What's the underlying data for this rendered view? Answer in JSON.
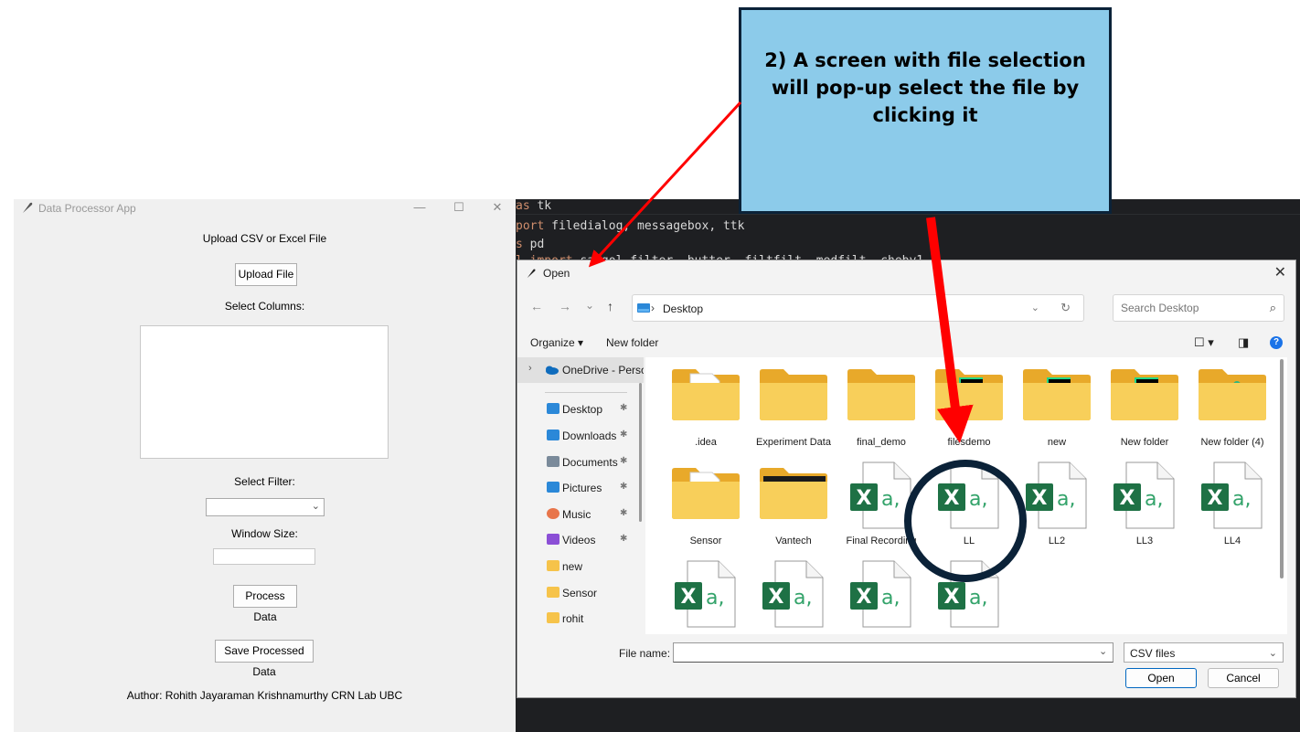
{
  "tk_app": {
    "title": "Data Processor App",
    "window_controls": {
      "minimize": "—",
      "maximize": "☐",
      "close": "✕"
    },
    "upload_label": "Upload CSV or Excel File",
    "upload_button": "Upload File",
    "select_columns_label": "Select Columns:",
    "select_filter_label": "Select Filter:",
    "filter_value": "",
    "window_size_label": "Window Size:",
    "window_size_value": "",
    "process_button": "Process Data",
    "save_button": "Save Processed Data",
    "author": "Author: Rohith Jayaraman Krishnamurthy  CRN Lab UBC"
  },
  "editor": {
    "lines": [
      {
        "kw": "as",
        "rest": " tk"
      },
      {
        "kw": "port",
        "rest": " filedialog, messagebox, ttk"
      },
      {
        "kw": "s",
        "rest": " pd"
      },
      {
        "kw": "l import",
        "rest": " savgol_filter, butter, filtfilt, medfilt, cheby1"
      }
    ]
  },
  "dialog": {
    "title": "Open",
    "close": "✕",
    "nav": {
      "back": "←",
      "forward": "→",
      "recent": "⌄",
      "up": "↑"
    },
    "breadcrumb": "Desktop",
    "breadcrumb_sep": "›",
    "address_dropdown": "⌄",
    "refresh": "↻",
    "search_placeholder": "Search Desktop",
    "organize": "Organize ▾",
    "new_folder": "New folder",
    "view_controls": {
      "layout": "☐ ▾",
      "pane": "◨",
      "help": "?"
    },
    "nav_pane": {
      "onedrive": "OneDrive - Perso",
      "items": [
        {
          "label": "Desktop",
          "icon": "desktop-icon",
          "pinned": true,
          "color": "#2b88d8"
        },
        {
          "label": "Downloads",
          "icon": "download-icon",
          "pinned": true,
          "color": "#2b88d8"
        },
        {
          "label": "Documents",
          "icon": "document-icon",
          "pinned": true,
          "color": "#7a8a9a"
        },
        {
          "label": "Pictures",
          "icon": "picture-icon",
          "pinned": true,
          "color": "#2b88d8"
        },
        {
          "label": "Music",
          "icon": "music-icon",
          "pinned": true,
          "color": "#e8754a"
        },
        {
          "label": "Videos",
          "icon": "video-icon",
          "pinned": true,
          "color": "#8b4fd6"
        },
        {
          "label": "new",
          "icon": "folder-icon",
          "pinned": false,
          "color": "#f6c34a"
        },
        {
          "label": "Sensor",
          "icon": "folder-icon",
          "pinned": false,
          "color": "#f6c34a"
        },
        {
          "label": "rohit",
          "icon": "folder-icon",
          "pinned": false,
          "color": "#f6c34a"
        }
      ]
    },
    "files": [
      {
        "name": ".idea",
        "kind": "folder-doc"
      },
      {
        "name": "Experiment Data",
        "kind": "folder"
      },
      {
        "name": "final_demo",
        "kind": "folder"
      },
      {
        "name": "filesdemo",
        "kind": "folder-pc"
      },
      {
        "name": "new",
        "kind": "folder-pc"
      },
      {
        "name": "New folder",
        "kind": "folder-pc"
      },
      {
        "name": "New folder (4)",
        "kind": "folder-slack"
      },
      {
        "name": "Sensor",
        "kind": "folder-doc"
      },
      {
        "name": "Vantech",
        "kind": "folder-dark"
      },
      {
        "name": "Final Recording",
        "kind": "excel"
      },
      {
        "name": "LL",
        "kind": "excel"
      },
      {
        "name": "LL2",
        "kind": "excel"
      },
      {
        "name": "LL3",
        "kind": "excel"
      },
      {
        "name": "LL4",
        "kind": "excel"
      },
      {
        "name": "",
        "kind": "excel"
      },
      {
        "name": "",
        "kind": "excel"
      },
      {
        "name": "",
        "kind": "excel"
      },
      {
        "name": "",
        "kind": "excel"
      }
    ],
    "excel_glyph": "X",
    "excel_suffix": "a,",
    "filename_label": "File name:",
    "filename_value": "",
    "filename_dropdown": "⌄",
    "file_type": "CSV files",
    "file_type_dropdown": "⌄",
    "open_button": "Open",
    "cancel_button": "Cancel"
  },
  "annotation": {
    "text": "2) A screen with file selection will pop-up select the file by clicking it",
    "arrow_color": "#ff0000",
    "circle_color": "#0b2238"
  },
  "colors": {
    "tk_bg": "#f0f0f0",
    "editor_bg": "#1e1f22",
    "callout_bg": "#8ccbea",
    "excel_green": "#1e7145",
    "folder_yellow": "#f6c34a"
  }
}
